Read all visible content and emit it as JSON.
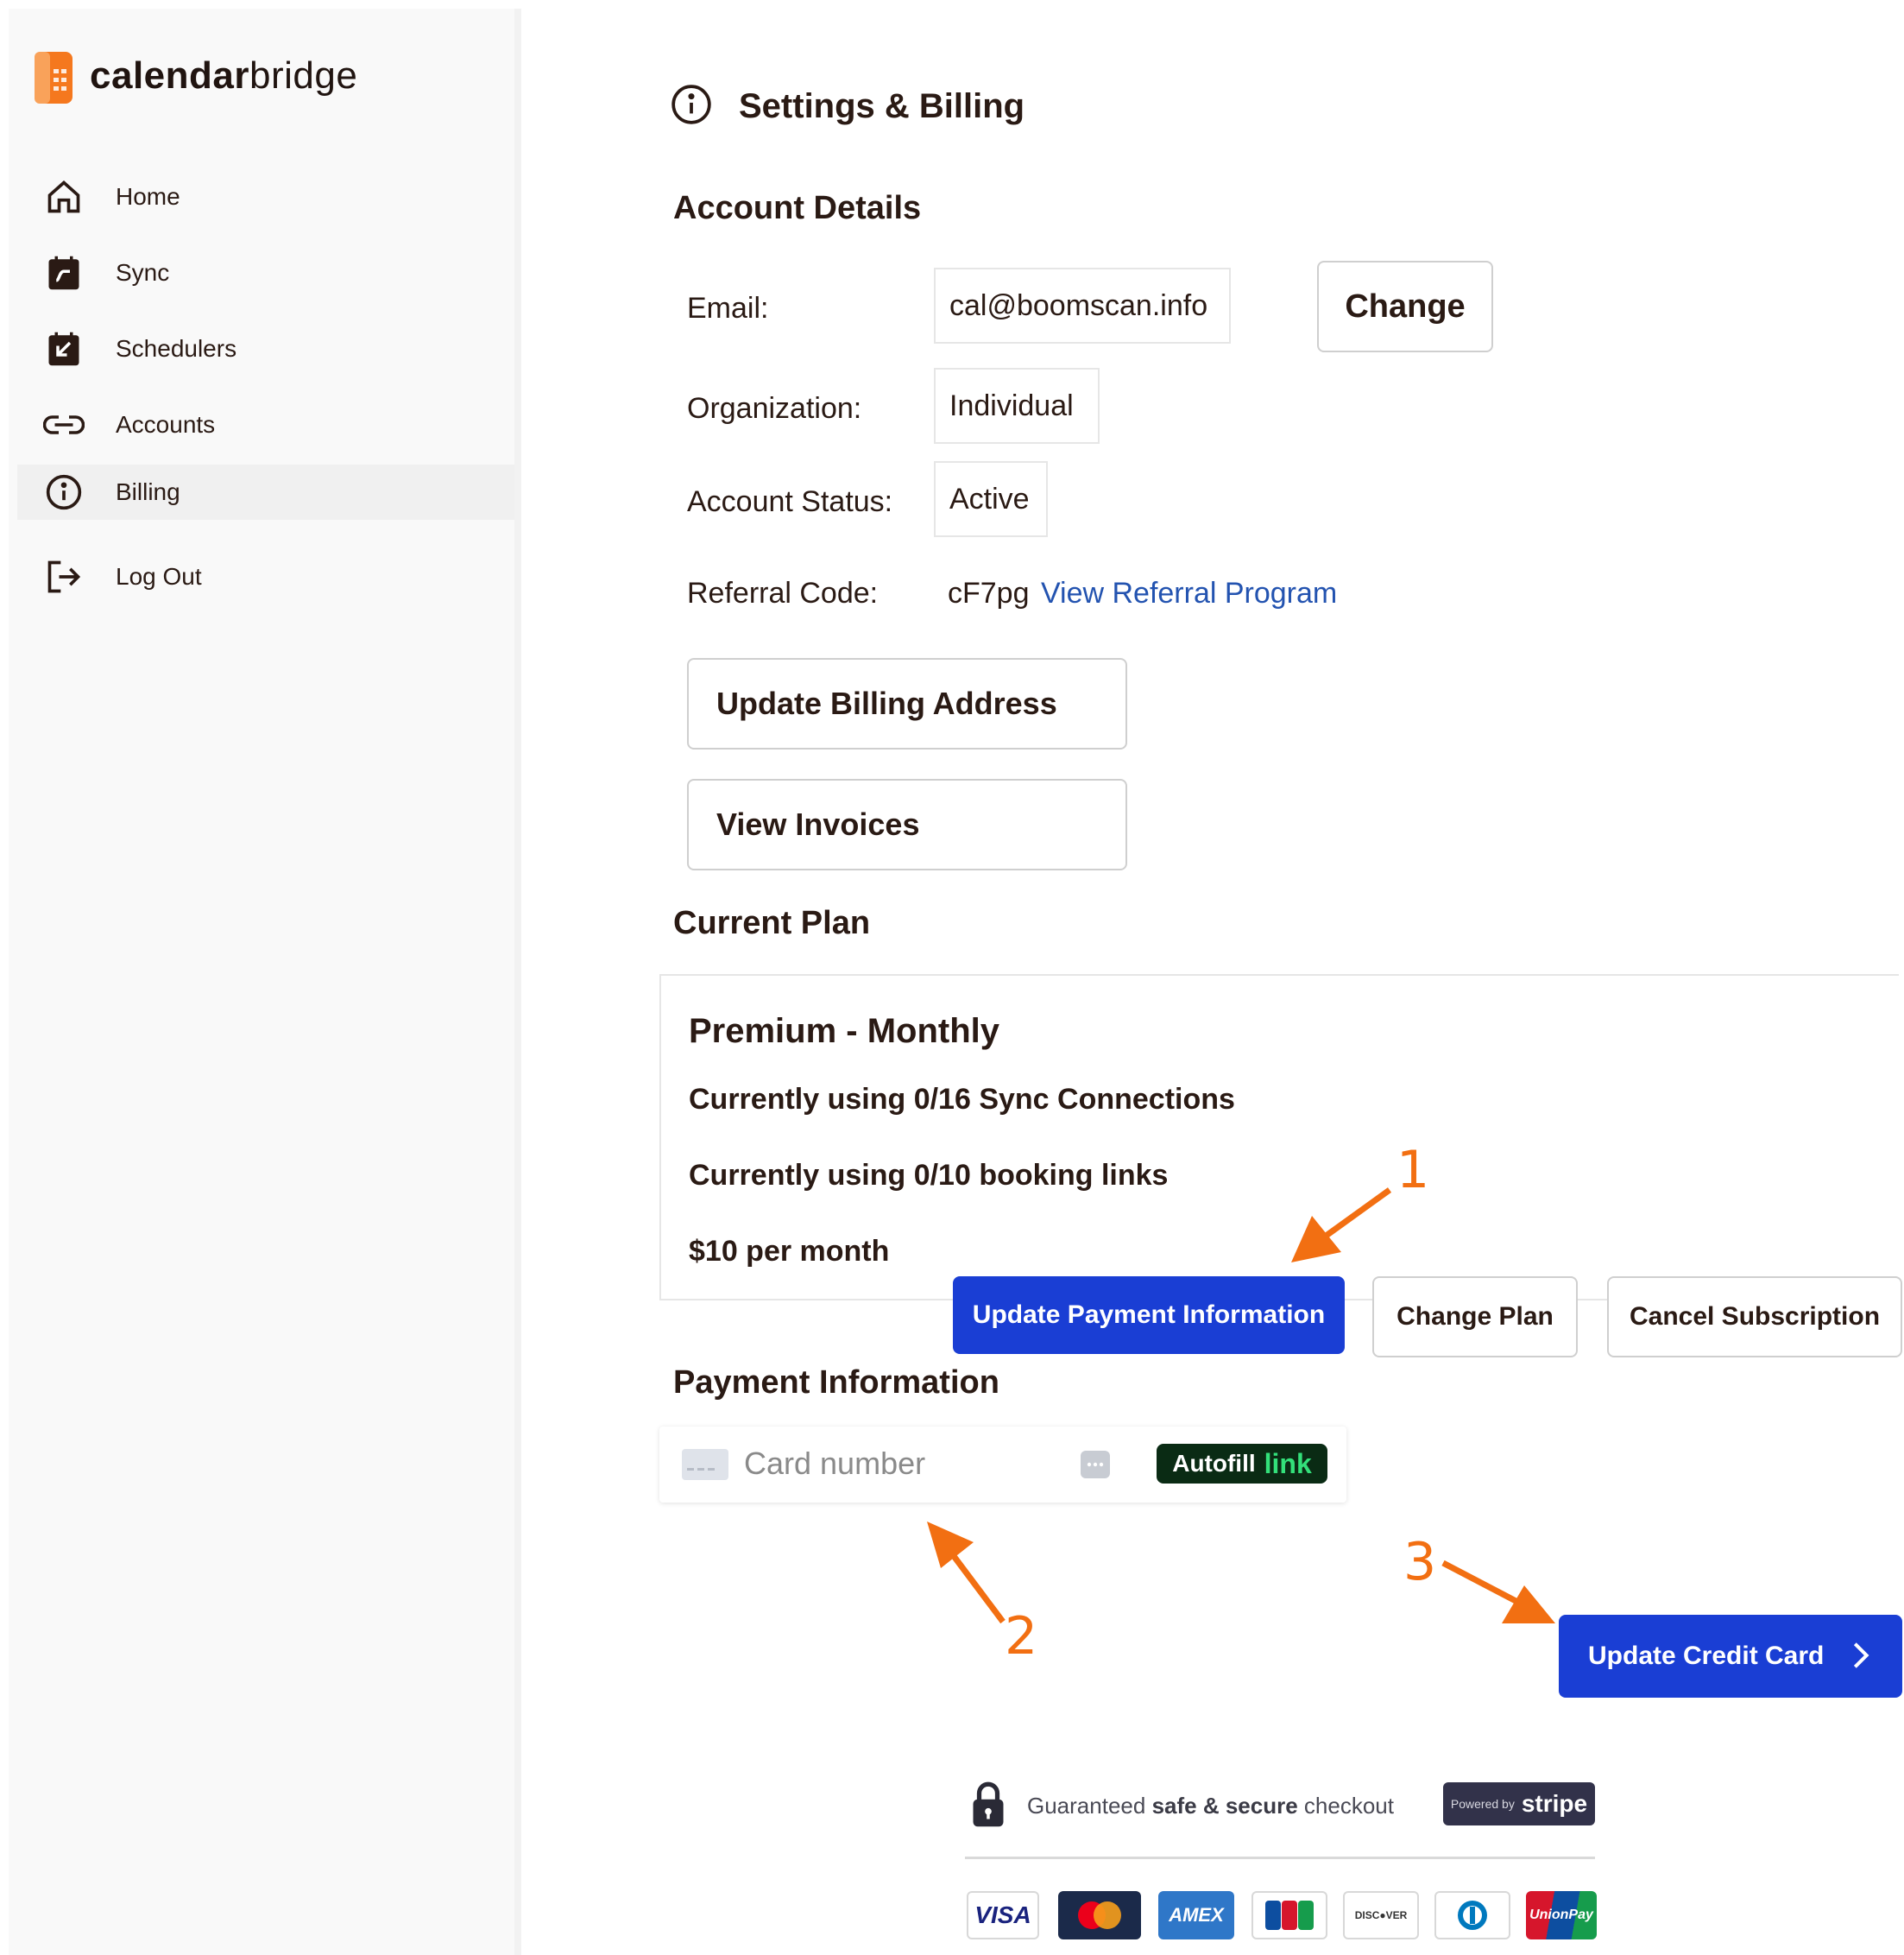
{
  "sidebar": {
    "logo": {
      "bold": "calendar",
      "regular": "bridge"
    },
    "items": [
      {
        "label": "Home",
        "icon": "home-icon"
      },
      {
        "label": "Sync",
        "icon": "sync-calendar-icon"
      },
      {
        "label": "Schedulers",
        "icon": "scheduler-calendar-icon"
      },
      {
        "label": "Accounts",
        "icon": "link-icon"
      },
      {
        "label": "Billing",
        "icon": "info-icon",
        "active": true
      },
      {
        "label": "Log Out",
        "icon": "logout-icon"
      }
    ]
  },
  "page": {
    "title": "Settings & Billing"
  },
  "account": {
    "heading": "Account Details",
    "email_label": "Email:",
    "email_value": "cal@boomscan.info",
    "change_button": "Change",
    "org_label": "Organization:",
    "org_value": "Individual",
    "status_label": "Account Status:",
    "status_value": "Active",
    "referral_label": "Referral Code:",
    "referral_code": "cF7pg",
    "referral_link": "View Referral Program",
    "update_billing_button": "Update Billing Address",
    "view_invoices_button": "View Invoices"
  },
  "plan": {
    "heading": "Current Plan",
    "name": "Premium - Monthly",
    "sync_usage": "Currently using 0/16 Sync Connections",
    "booking_usage": "Currently using 0/10 booking links",
    "price": "$10 per month",
    "update_payment_button": "Update Payment Information",
    "change_plan_button": "Change Plan",
    "cancel_button": "Cancel Subscription"
  },
  "payment": {
    "heading": "Payment Information",
    "card_placeholder": "Card number",
    "autofill_label": "Autofill",
    "autofill_brand": "link",
    "update_card_button": "Update Credit Card",
    "secure_prefix": "Guaranteed",
    "secure_bold": "safe & secure",
    "secure_suffix": "checkout",
    "powered_by": "Powered by",
    "stripe": "stripe",
    "card_brands": [
      "VISA",
      "AMEX",
      "DISC●VER",
      "UnionPay"
    ]
  },
  "annotations": [
    "1",
    "2",
    "3"
  ],
  "colors": {
    "primary": "#1a3ed4",
    "annotation": "#f26f12",
    "link": "#2353b0",
    "logo_orange": "#f5781e"
  }
}
